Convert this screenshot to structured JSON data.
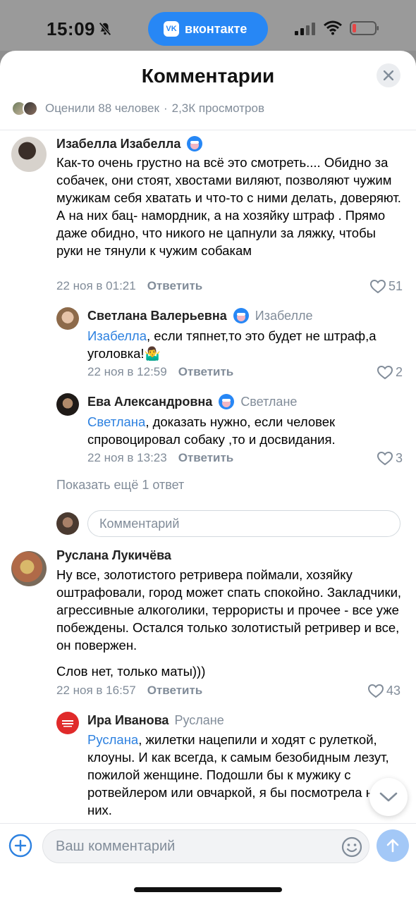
{
  "status_bar": {
    "time": "15:09",
    "app_pill": "вконтакте",
    "vk_logo": "VK"
  },
  "sheet": {
    "title": "Комментарии",
    "stats": {
      "rated": "Оценили 88 человек",
      "separator": "·",
      "views": "2,3К просмотров"
    }
  },
  "comments": [
    {
      "author": "Изабелла Изабелла",
      "text": "Как-то очень грустно на всё это смотреть.... Обидно за собачек, они стоят, хвостами виляют, позволяют чужим мужикам себя хватать и что-то с ними делать, доверяют. А на них бац- намордник, а на хозяйку штраф . Прямо даже обидно, что никого не цапнули за ляжку, чтобы руки не тянули к чужим собакам",
      "date": "22 ноя в 01:21",
      "reply_label": "Ответить",
      "likes": "51"
    },
    {
      "author": "Светлана Валерьевна",
      "reply_to": "Изабелле",
      "mention": "Изабелла",
      "text": ", если тяпнет,то это будет не штраф,а уголовка!🤷‍♂️",
      "date": "22 ноя в 12:59",
      "reply_label": "Ответить",
      "likes": "2"
    },
    {
      "author": "Ева Александровна",
      "reply_to": "Светлане",
      "mention": "Светлана",
      "text": ", доказать нужно, если человек спровоцировал собаку ,то и досвидания.",
      "date": "22 ноя в 13:23",
      "reply_label": "Ответить",
      "likes": "3"
    },
    {
      "author": "Руслана Лукичёва",
      "text": "Ну все, золотистого ретривера поймали, хозяйку оштрафовали, город может спать спокойно. Закладчики, агрессивные алкоголики, террористы и прочее - все уже побеждены. Остался только золотистый ретривер и все, он повержен.",
      "text2": "Слов нет, только маты)))",
      "date": "22 ноя в 16:57",
      "reply_label": "Ответить",
      "likes": "43"
    },
    {
      "author": "Ира Иванова",
      "reply_to": "Руслане",
      "mention": "Руслана",
      "text": ", жилетки нацепили и ходят с рулеткой, клоуны. И как всегда, к самым безобидным лезут, пожилой женщине. Подошли бы к мужику с ротвейлером или овчаркой, я бы посмотрела на них."
    }
  ],
  "show_more": "Показать ещё 1 ответ",
  "inline_comment_placeholder": "Комментарий",
  "compose_placeholder": "Ваш комментарий",
  "colors": {
    "accent": "#2d81e0",
    "muted": "#818c99",
    "vk_blue": "#2787f5",
    "send_disabled": "#a3c8f7"
  }
}
